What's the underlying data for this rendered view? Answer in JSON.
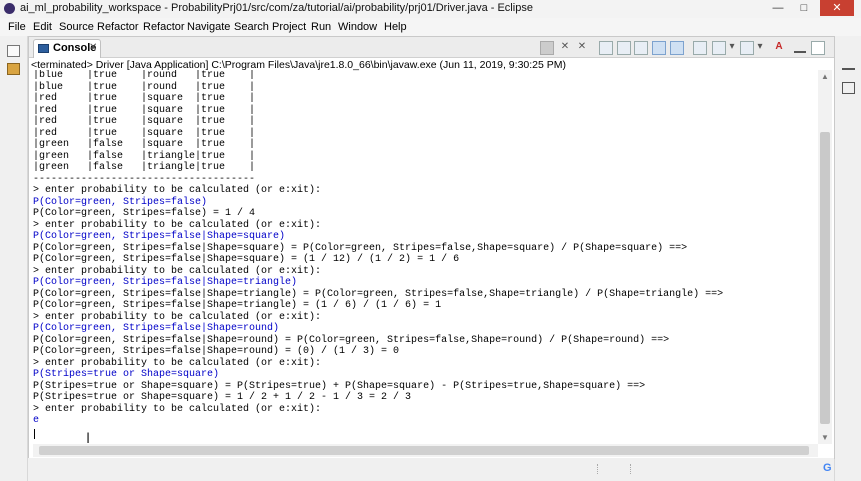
{
  "window": {
    "title": "ai_ml_probability_workspace - ProbabilityPrj01/src/com/za/tutorial/ai/probability/prj01/Driver.java - Eclipse",
    "minimize": "—",
    "maximize": "□",
    "close": "✕"
  },
  "menu": [
    "File",
    "Edit",
    "Source",
    "Refactor",
    "Refactor",
    "Navigate",
    "Search",
    "Project",
    "Run",
    "Window",
    "Help"
  ],
  "console": {
    "tab_label": "Console",
    "tab_close": "✕",
    "status": "<terminated> Driver [Java Application] C:\\Program Files\\Java\\jre1.8.0_66\\bin\\javaw.exe (Jun 11, 2019, 9:30:25 PM)",
    "lines": [
      {
        "text": "|blue    |true    |round   |true    |",
        "kind": "out"
      },
      {
        "text": "|blue    |true    |round   |true    |",
        "kind": "out"
      },
      {
        "text": "|red     |true    |square  |true    |",
        "kind": "out"
      },
      {
        "text": "|red     |true    |square  |true    |",
        "kind": "out"
      },
      {
        "text": "|red     |true    |square  |true    |",
        "kind": "out"
      },
      {
        "text": "|red     |true    |square  |true    |",
        "kind": "out"
      },
      {
        "text": "|green   |false   |square  |true    |",
        "kind": "out"
      },
      {
        "text": "|green   |false   |triangle|true    |",
        "kind": "out"
      },
      {
        "text": "|green   |false   |triangle|true    |",
        "kind": "out"
      },
      {
        "text": "-------------------------------------",
        "kind": "out"
      },
      {
        "text": "> enter probability to be calculated (or e:xit):",
        "kind": "out"
      },
      {
        "text": "P(Color=green, Stripes=false)",
        "kind": "in"
      },
      {
        "text": "P(Color=green, Stripes=false) = 1 / 4",
        "kind": "out"
      },
      {
        "text": "> enter probability to be calculated (or e:xit):",
        "kind": "out"
      },
      {
        "text": "P(Color=green, Stripes=false|Shape=square)",
        "kind": "in"
      },
      {
        "text": "P(Color=green, Stripes=false|Shape=square) = P(Color=green, Stripes=false,Shape=square) / P(Shape=square) ==>",
        "kind": "out"
      },
      {
        "text": "P(Color=green, Stripes=false|Shape=square) = (1 / 12) / (1 / 2) = 1 / 6",
        "kind": "out"
      },
      {
        "text": "> enter probability to be calculated (or e:xit):",
        "kind": "out"
      },
      {
        "text": "P(Color=green, Stripes=false|Shape=triangle)",
        "kind": "in"
      },
      {
        "text": "P(Color=green, Stripes=false|Shape=triangle) = P(Color=green, Stripes=false,Shape=triangle) / P(Shape=triangle) ==>",
        "kind": "out"
      },
      {
        "text": "P(Color=green, Stripes=false|Shape=triangle) = (1 / 6) / (1 / 6) = 1",
        "kind": "out"
      },
      {
        "text": "> enter probability to be calculated (or e:xit):",
        "kind": "out"
      },
      {
        "text": "P(Color=green, Stripes=false|Shape=round)",
        "kind": "in"
      },
      {
        "text": "P(Color=green, Stripes=false|Shape=round) = P(Color=green, Stripes=false,Shape=round) / P(Shape=round) ==>",
        "kind": "out"
      },
      {
        "text": "P(Color=green, Stripes=false|Shape=round) = (0) / (1 / 3) = 0",
        "kind": "out"
      },
      {
        "text": "> enter probability to be calculated (or e:xit):",
        "kind": "out"
      },
      {
        "text": "P(Stripes=true or Shape=square)",
        "kind": "in"
      },
      {
        "text": "P(Stripes=true or Shape=square) = P(Stripes=true) + P(Shape=square) - P(Stripes=true,Shape=square) ==>",
        "kind": "out"
      },
      {
        "text": "P(Stripes=true or Shape=square) = 1 / 2 + 1 / 2 - 1 / 3 = 2 / 3",
        "kind": "out"
      },
      {
        "text": "> enter probability to be calculated (or e:xit):",
        "kind": "out"
      },
      {
        "text": "e",
        "kind": "in"
      }
    ]
  },
  "colors": {
    "input_text": "#0000c8",
    "output_text": "#000000",
    "close_button": "#c84031"
  },
  "icons": {
    "left_gutter": [
      "restore-icon",
      "package-explorer-icon"
    ],
    "right_gutter": [
      "minimize-icon",
      "maximize-icon",
      "restore-icon"
    ],
    "status_bar": [
      "google-icon",
      "gripper-icon"
    ]
  }
}
